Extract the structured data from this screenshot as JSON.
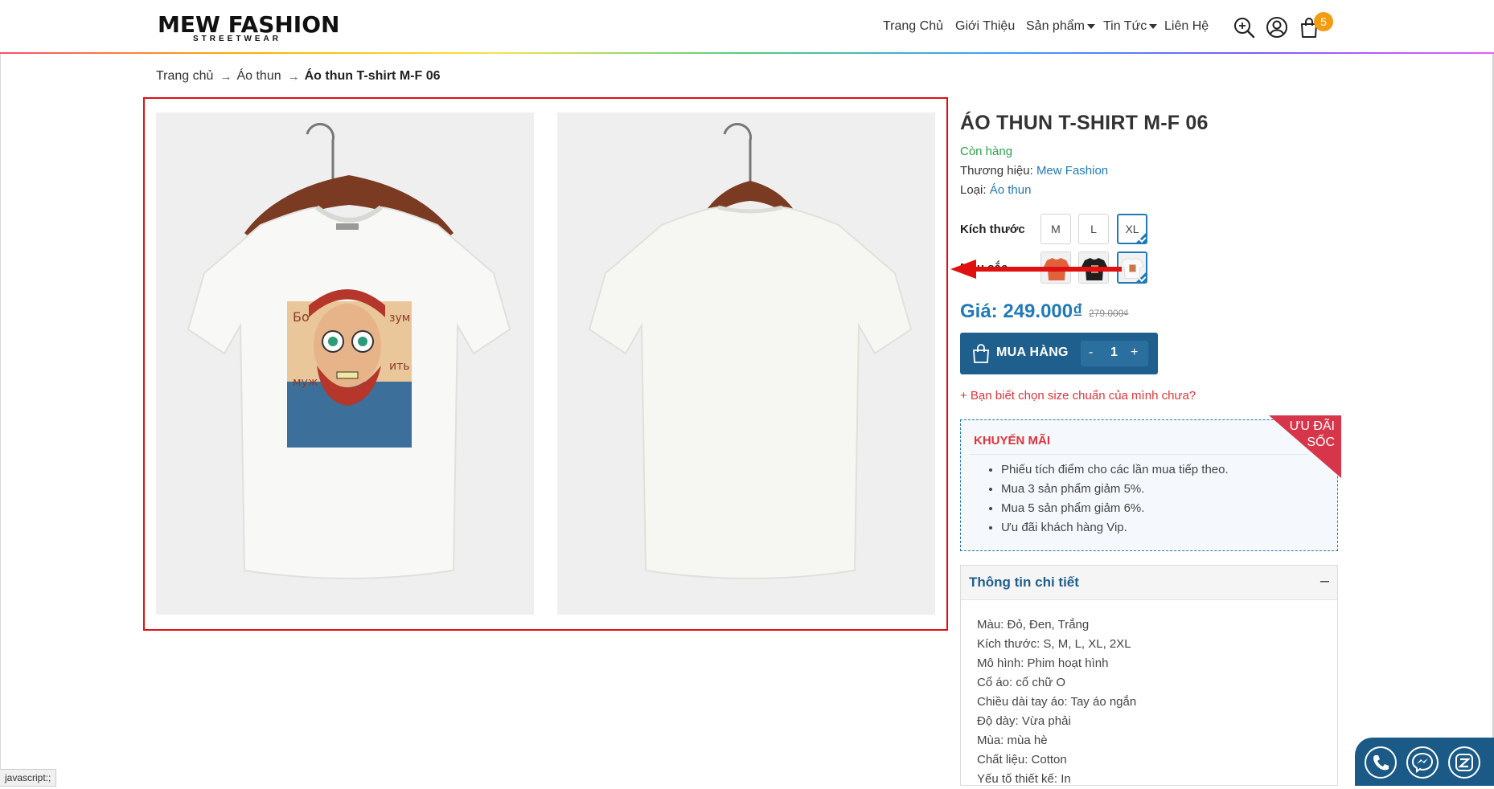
{
  "header": {
    "logo_main": "MEW FASHION",
    "logo_sub": "STREETWEAR",
    "nav": [
      "Trang Chủ",
      "Giới Thiệu",
      "Sản phẩm",
      "Tin Tức",
      "Liên Hệ"
    ],
    "cart_count": "5",
    "icons": [
      "search-icon",
      "user-icon",
      "cart-icon"
    ]
  },
  "breadcrumb": {
    "home": "Trang chủ",
    "category": "Áo thun",
    "current": "Áo thun T-shirt M-F 06"
  },
  "product": {
    "title": "ÁO THUN T-SHIRT M-F 06",
    "stock": "Còn hàng",
    "brand_label": "Thương hiệu:",
    "brand": "Mew Fashion",
    "type_label": "Loại:",
    "type": "Áo thun",
    "size_label": "Kích thước",
    "sizes": [
      "M",
      "L",
      "XL"
    ],
    "selected_size": "XL",
    "color_label": "Màu sắc",
    "colors": [
      "orange",
      "black",
      "white"
    ],
    "selected_color": "white",
    "price_label": "Giá:",
    "price": "249.000₫",
    "old_price": "279.000₫",
    "buy_label": "MUA HÀNG",
    "qty_minus": "-",
    "qty": "1",
    "qty_plus": "+",
    "size_guide": "+ Bạn biết chọn size chuẩn của mình chưa?"
  },
  "promo": {
    "title": "KHUYẾN MÃI",
    "ribbon_line1": "ƯU ĐÃI",
    "ribbon_line2": "SỐC",
    "items": [
      "Phiếu tích điểm cho các lần mua tiếp theo.",
      "Mua 3 sản phẩm giảm 5%.",
      "Mua 5 sản phẩm giảm 6%.",
      "Ưu đãi khách hàng Vip."
    ]
  },
  "details": {
    "title": "Thông tin chi tiết",
    "toggle": "–",
    "items": [
      "Màu: Đỏ, Đen, Trắng",
      "Kích thước: S, M, L, XL, 2XL",
      "Mô hình: Phim hoạt hình",
      "Cổ áo: cổ chữ O",
      "Chiều dài tay áo: Tay áo ngắn",
      "Độ dày: Vừa phải",
      "Mùa: mùa hè",
      "Chất liệu: Cotton",
      "Yếu tố thiết kế: In"
    ]
  },
  "status_bar": "javascript:;",
  "contact": [
    "phone-icon",
    "messenger-icon",
    "zalo-icon"
  ],
  "colors": {
    "accent": "#1f7ab8",
    "buy": "#1f5f8e",
    "stock": "#2ba24c",
    "alert": "#e0343a",
    "badge": "#f39c12"
  }
}
